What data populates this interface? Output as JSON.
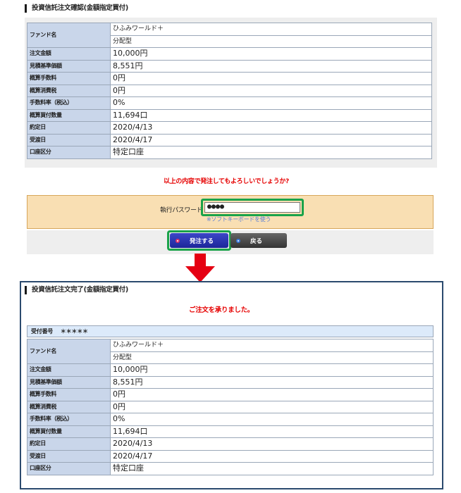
{
  "confirm_section": {
    "title": "投資信託注文確認(金額指定買付)",
    "rows": [
      {
        "label": "ファンド名",
        "value": "ひふみワールド＋",
        "value2": "分配型"
      },
      {
        "label": "注文金額",
        "value": "10,000円"
      },
      {
        "label": "見積基準価額",
        "value": "8,551円"
      },
      {
        "label": "概算手数料",
        "value": "0円"
      },
      {
        "label": "概算消費税",
        "value": "0円"
      },
      {
        "label": "手数料率（税込）",
        "value": "0%"
      },
      {
        "label": "概算買付数量",
        "value": "11,694口"
      },
      {
        "label": "約定日",
        "value": "2020/4/13"
      },
      {
        "label": "受渡日",
        "value": "2020/4/17"
      },
      {
        "label": "口座区分",
        "value": "特定口座"
      }
    ],
    "question": "以上の内容で発注してもよろしいでしょうか?",
    "password_label": "執行パスワード",
    "password_value": "●●●●",
    "soft_keyboard_link": "※ソフトキーボードを使う",
    "submit_button": "発注する",
    "back_button": "戻る"
  },
  "done_section": {
    "title": "投資信託注文完了(金額指定買付)",
    "message": "ご注文を承りました。",
    "receipt_label": "受付番号",
    "receipt_value": "＊＊＊＊＊",
    "rows": [
      {
        "label": "ファンド名",
        "value": "ひふみワールド＋",
        "value2": "分配型"
      },
      {
        "label": "注文金額",
        "value": "10,000円"
      },
      {
        "label": "見積基準価額",
        "value": "8,551円"
      },
      {
        "label": "概算手数料",
        "value": "0円"
      },
      {
        "label": "概算消費税",
        "value": "0円"
      },
      {
        "label": "手数料率（税込）",
        "value": "0%"
      },
      {
        "label": "概算買付数量",
        "value": "11,694口"
      },
      {
        "label": "約定日",
        "value": "2020/4/13"
      },
      {
        "label": "受渡日",
        "value": "2020/4/17"
      },
      {
        "label": "口座区分",
        "value": "特定口座"
      }
    ]
  },
  "colors": {
    "highlight": "#1aa34a",
    "arrow": "#e50012",
    "label_bg": "#c9d6ea",
    "warning_text": "#e60000"
  },
  "icons": {
    "flow_arrow": "down-arrow-icon"
  }
}
